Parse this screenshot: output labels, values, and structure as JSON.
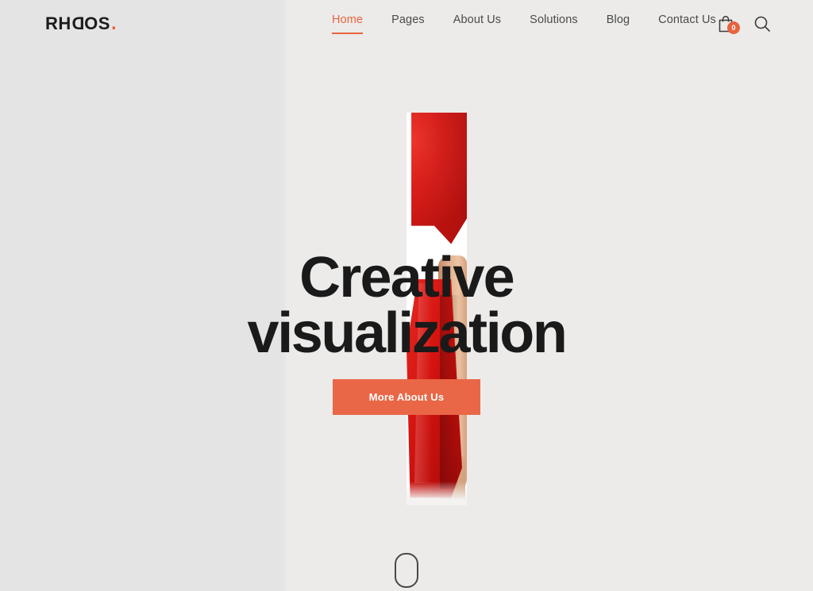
{
  "site": {
    "logo_text_part1": "RH",
    "logo_text_mirror": "D",
    "logo_text_part2": "OS",
    "logo_dot": ".",
    "logo_full": "RHODOS.",
    "accent_color": "#e8633f",
    "cta_color": "#e96746",
    "text_color": "#1a1a1a",
    "bg_left_color": "#e5e4e4",
    "bg_right_color": "#ecebe9"
  },
  "nav": {
    "items": [
      {
        "label": "Home",
        "active": true
      },
      {
        "label": "Pages",
        "active": false
      },
      {
        "label": "About Us",
        "active": false
      },
      {
        "label": "Solutions",
        "active": false
      },
      {
        "label": "Blog",
        "active": false
      },
      {
        "label": "Contact Us",
        "active": false
      }
    ]
  },
  "header_actions": {
    "cart_icon": "shopping-bag-icon",
    "cart_count": "0",
    "search_icon": "search-icon"
  },
  "hero": {
    "title_line1": "Creative",
    "title_line2": "visualization",
    "cta_label": "More About Us",
    "image_alt": "person in red dress"
  },
  "scroll": {
    "indicator": "mouse-scroll-icon"
  }
}
